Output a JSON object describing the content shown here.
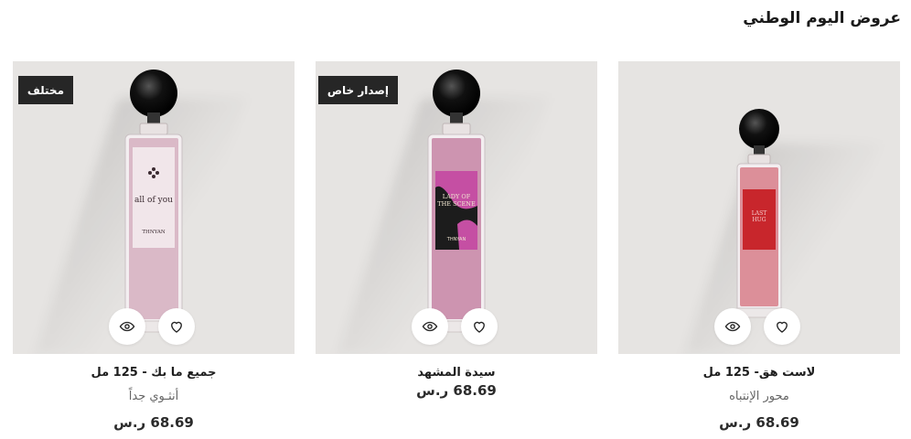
{
  "section": {
    "title": "عروض اليوم الوطني"
  },
  "products": [
    {
      "name": "لاست هق- 125 مل",
      "subtitle": "محور الإنتباه",
      "price_value": "68.69",
      "currency": "ر.س",
      "badge": "",
      "label_text": "LAST HUG",
      "label_color": "#c8262c",
      "liquid_color": "#d9848f"
    },
    {
      "name": "سيدة المشهد",
      "subtitle": "",
      "price_value": "68.69",
      "currency": "ر.س",
      "badge": "إصدار خاص",
      "label_line1": "LADY OF",
      "label_line2": "THE SCENE",
      "label_brand": "THNYAN",
      "label_color": "#c54fa3",
      "liquid_color": "#c98aa9"
    },
    {
      "name": "جميع ما بك - 125 مل",
      "subtitle": "أنثـوي جداً",
      "price_value": "68.69",
      "currency": "ر.س",
      "badge": "مختلف",
      "label_text": "all of you",
      "label_brand": "THNYAN",
      "label_color": "#f1e6ea",
      "liquid_color": "#d7b3c2"
    }
  ],
  "icons": {
    "wishlist": "heart-icon",
    "quick_view": "eye-icon"
  }
}
